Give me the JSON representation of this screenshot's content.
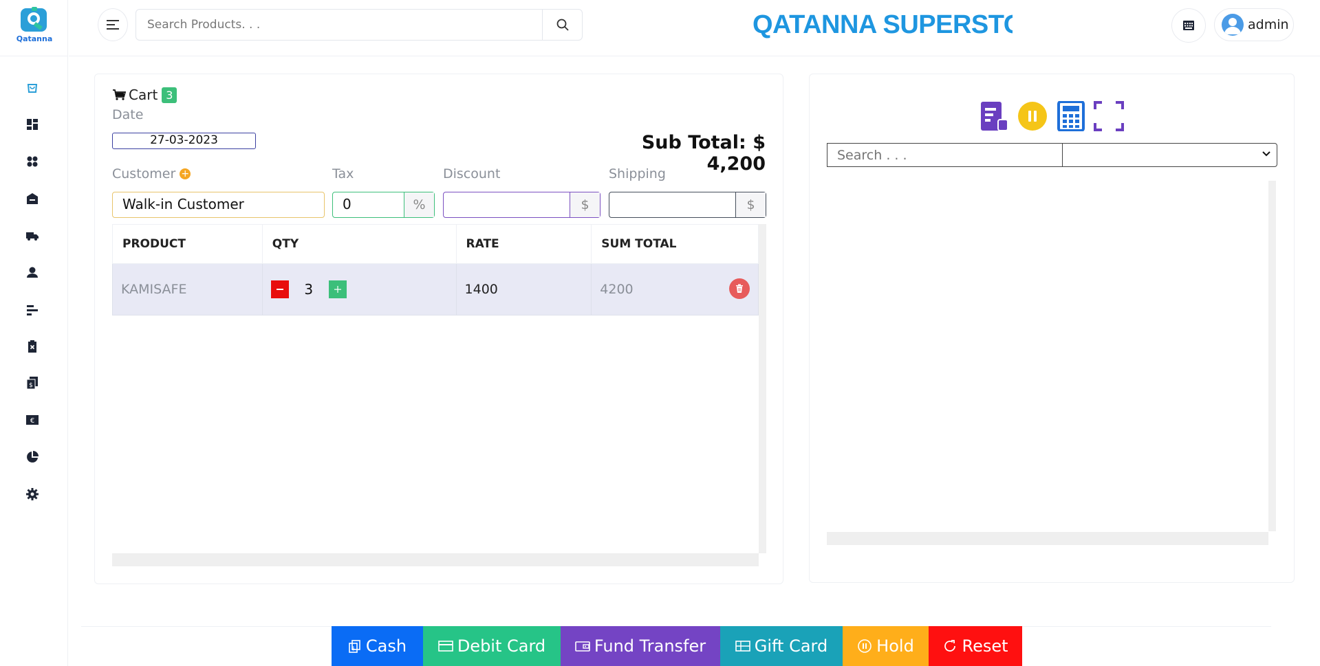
{
  "brand": {
    "logo_text": "Qatanna",
    "store_name": "QATANNA SUPERSTORE"
  },
  "header": {
    "search_placeholder": "Search Products. . .",
    "user_name": "admin"
  },
  "sidebar": {
    "items": [
      {
        "icon": "shopping-bag-icon"
      },
      {
        "icon": "dashboard-icon"
      },
      {
        "icon": "products-icon"
      },
      {
        "icon": "warehouse-icon"
      },
      {
        "icon": "truck-icon"
      },
      {
        "icon": "user-icon"
      },
      {
        "icon": "reports-icon"
      },
      {
        "icon": "returns-icon"
      },
      {
        "icon": "expenses-icon"
      },
      {
        "icon": "currency-icon"
      },
      {
        "icon": "pie-chart-icon"
      },
      {
        "icon": "settings-icon"
      }
    ]
  },
  "cart": {
    "title": "Cart",
    "count": "3",
    "date_label": "Date",
    "date_value": "27-03-2023",
    "subtotal_text": "Sub Total: $ 4,200",
    "customer_label": "Customer",
    "customer_value": "Walk-in Customer",
    "tax_label": "Tax",
    "tax_value": "0",
    "tax_unit": "%",
    "discount_label": "Discount",
    "discount_value": "",
    "discount_unit": "$",
    "shipping_label": "Shipping",
    "shipping_value": "",
    "shipping_unit": "$",
    "columns": [
      "PRODUCT",
      "QTY",
      "RATE",
      "SUM TOTAL"
    ],
    "rows": [
      {
        "product": "KAMISAFE",
        "qty": "3",
        "rate": "1400",
        "sum_total": "4200"
      }
    ]
  },
  "right_panel": {
    "search_placeholder": "Search . . .",
    "category_selected": ""
  },
  "payment": {
    "buttons": [
      {
        "label": "Cash",
        "color": "#0a6cf5"
      },
      {
        "label": "Debit Card",
        "color": "#26c487"
      },
      {
        "label": "Fund Transfer",
        "color": "#7444c4"
      },
      {
        "label": "Gift Card",
        "color": "#1aa2b8"
      },
      {
        "label": "Hold",
        "color": "#ffae1a"
      },
      {
        "label": "Reset",
        "color": "#ff1010"
      }
    ]
  },
  "colors": {
    "brand_blue": "#1e96e0",
    "accent_green": "#3cbf7a",
    "danger_red": "#e80d0d"
  }
}
